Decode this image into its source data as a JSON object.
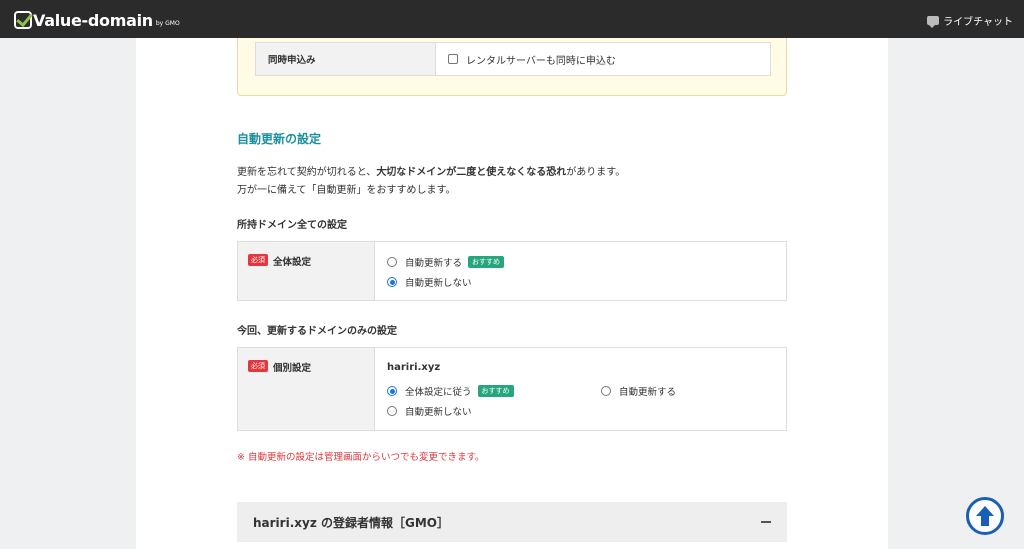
{
  "header": {
    "logo_text": "Value-domain",
    "logo_sub": "by GMO",
    "live_chat": "ライブチャット"
  },
  "simultaneous": {
    "label": "同時申込み",
    "checkbox_label": "レンタルサーバーも同時に申込む",
    "checked": false
  },
  "auto_renew": {
    "title": "自動更新の設定",
    "desc_line1_a": "更新を忘れて契約が切れると、",
    "desc_line1_b": "大切なドメインが二度と使えなくなる恐れ",
    "desc_line1_c": "があります。",
    "desc_line2": "万が一に備えて「自動更新」をおすすめします。",
    "all_section_title": "所持ドメイン全ての設定",
    "all_table": {
      "required": "必須",
      "label": "全体設定",
      "opt_on": "自動更新する",
      "recommend": "おすすめ",
      "opt_off": "自動更新しない",
      "selected": "opt_off"
    },
    "individual_section_title": "今回、更新するドメインのみの設定",
    "individual_table": {
      "required": "必須",
      "label": "個別設定",
      "domain": "hariri.xyz",
      "opt_follow": "全体設定に従う",
      "recommend": "おすすめ",
      "opt_on": "自動更新する",
      "opt_off": "自動更新しない",
      "selected": "opt_follow"
    },
    "note": "※ 自動更新の設定は管理画面からいつでも変更できます。"
  },
  "registrant": {
    "title": "hariri.xyz の登録者情報［GMO］"
  },
  "colors": {
    "accent": "#1e8fa0",
    "required": "#e0383e",
    "recommend": "#25a67d",
    "radio": "#1a73e8"
  }
}
